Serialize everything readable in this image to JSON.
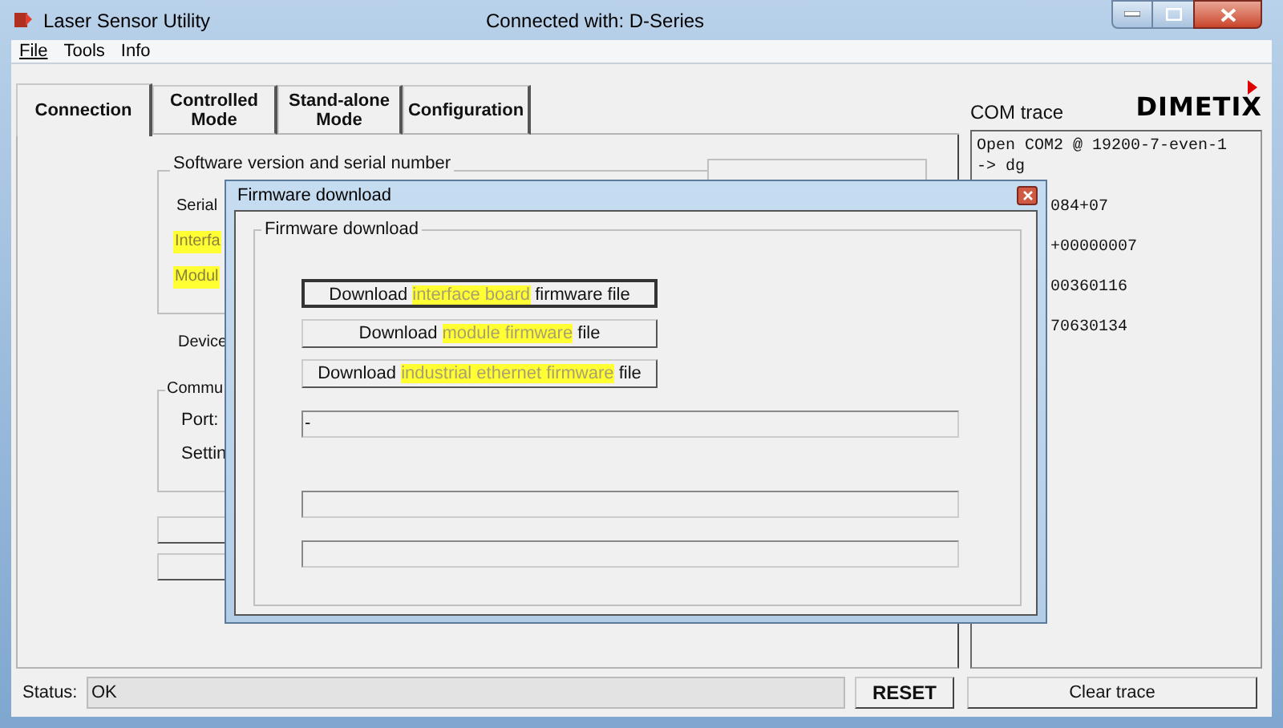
{
  "window": {
    "title": "Laser Sensor Utility",
    "connection": "Connected with: D-Series"
  },
  "menu": [
    "File",
    "Tools",
    "Info"
  ],
  "tabs": [
    {
      "label": "Connection",
      "selected": true
    },
    {
      "label": "Controlled Mode",
      "selected": false
    },
    {
      "label": "Stand-alone Mode",
      "selected": false
    },
    {
      "label": "Configuration",
      "selected": false
    }
  ],
  "software_group": {
    "title": "Software version and serial number",
    "labels": [
      {
        "text": "Serial",
        "highlight": false
      },
      {
        "text": "Interfa",
        "highlight": true
      },
      {
        "text": "Modul",
        "highlight": true
      }
    ]
  },
  "device_label": "Device",
  "comm_group": {
    "title": "Commu",
    "labels": [
      "Port:",
      "Settin"
    ]
  },
  "com_trace": {
    "title": "COM trace",
    "logo": "DIMETIX",
    "lines": [
      "Open COM2 @ 19200-7-even-1",
      "-> dg",
      "084+07",
      "+00000007",
      "00360116",
      "70630134"
    ]
  },
  "status": {
    "label": "Status:",
    "value": "OK"
  },
  "buttons": {
    "reset": "RESET",
    "clear": "Clear trace"
  },
  "dialog": {
    "title": "Firmware download",
    "group_title": "Firmware download",
    "buttons": [
      {
        "focused": true,
        "parts": [
          {
            "text": "Download ",
            "highlight": false
          },
          {
            "text": "interface board",
            "highlight": true
          },
          {
            "text": " firmware file",
            "highlight": false
          }
        ]
      },
      {
        "focused": false,
        "parts": [
          {
            "text": "Download ",
            "highlight": false
          },
          {
            "text": "module firmware",
            "highlight": true
          },
          {
            "text": " file",
            "highlight": false
          }
        ]
      },
      {
        "focused": false,
        "parts": [
          {
            "text": "Download ",
            "highlight": false
          },
          {
            "text": "industrial ethernet firmware",
            "highlight": true
          },
          {
            "text": " file",
            "highlight": false
          }
        ]
      }
    ],
    "progress_field": "-"
  }
}
